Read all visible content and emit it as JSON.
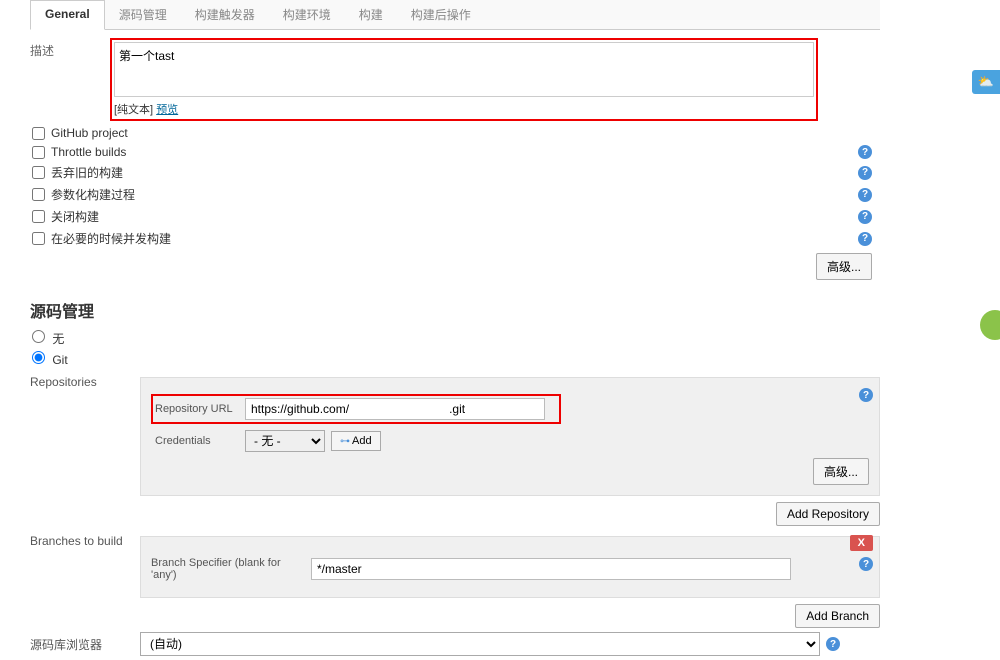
{
  "tabs": [
    {
      "label": "General"
    },
    {
      "label": "源码管理"
    },
    {
      "label": "构建触发器"
    },
    {
      "label": "构建环境"
    },
    {
      "label": "构建"
    },
    {
      "label": "构建后操作"
    }
  ],
  "description": {
    "label": "描述",
    "value": "第一个tast",
    "format_plain": "[纯文本]",
    "format_preview": "预览"
  },
  "checkboxes": [
    {
      "label": "GitHub project",
      "has_help": false
    },
    {
      "label": "Throttle builds",
      "has_help": true
    },
    {
      "label": "丢弃旧的构建",
      "has_help": true
    },
    {
      "label": "参数化构建过程",
      "has_help": true
    },
    {
      "label": "关闭构建",
      "has_help": true
    },
    {
      "label": "在必要的时候并发构建",
      "has_help": true
    }
  ],
  "advanced_btn": "高级...",
  "scm": {
    "heading": "源码管理",
    "radio_none": "无",
    "radio_git": "Git",
    "repositories_label": "Repositories",
    "repo_url_label": "Repository URL",
    "repo_url_value": "https://github.com/                              .git",
    "credentials_label": "Credentials",
    "credentials_value": "- 无 -",
    "add_btn": "Add",
    "add_repository_btn": "Add Repository",
    "branches_label": "Branches to build",
    "branch_specifier_label": "Branch Specifier (blank for 'any')",
    "branch_specifier_value": "*/master",
    "add_branch_btn": "Add Branch",
    "delete_badge": "X",
    "repo_browser_label": "源码库浏览器",
    "repo_browser_value": "(自动)"
  },
  "help_icon": "?"
}
